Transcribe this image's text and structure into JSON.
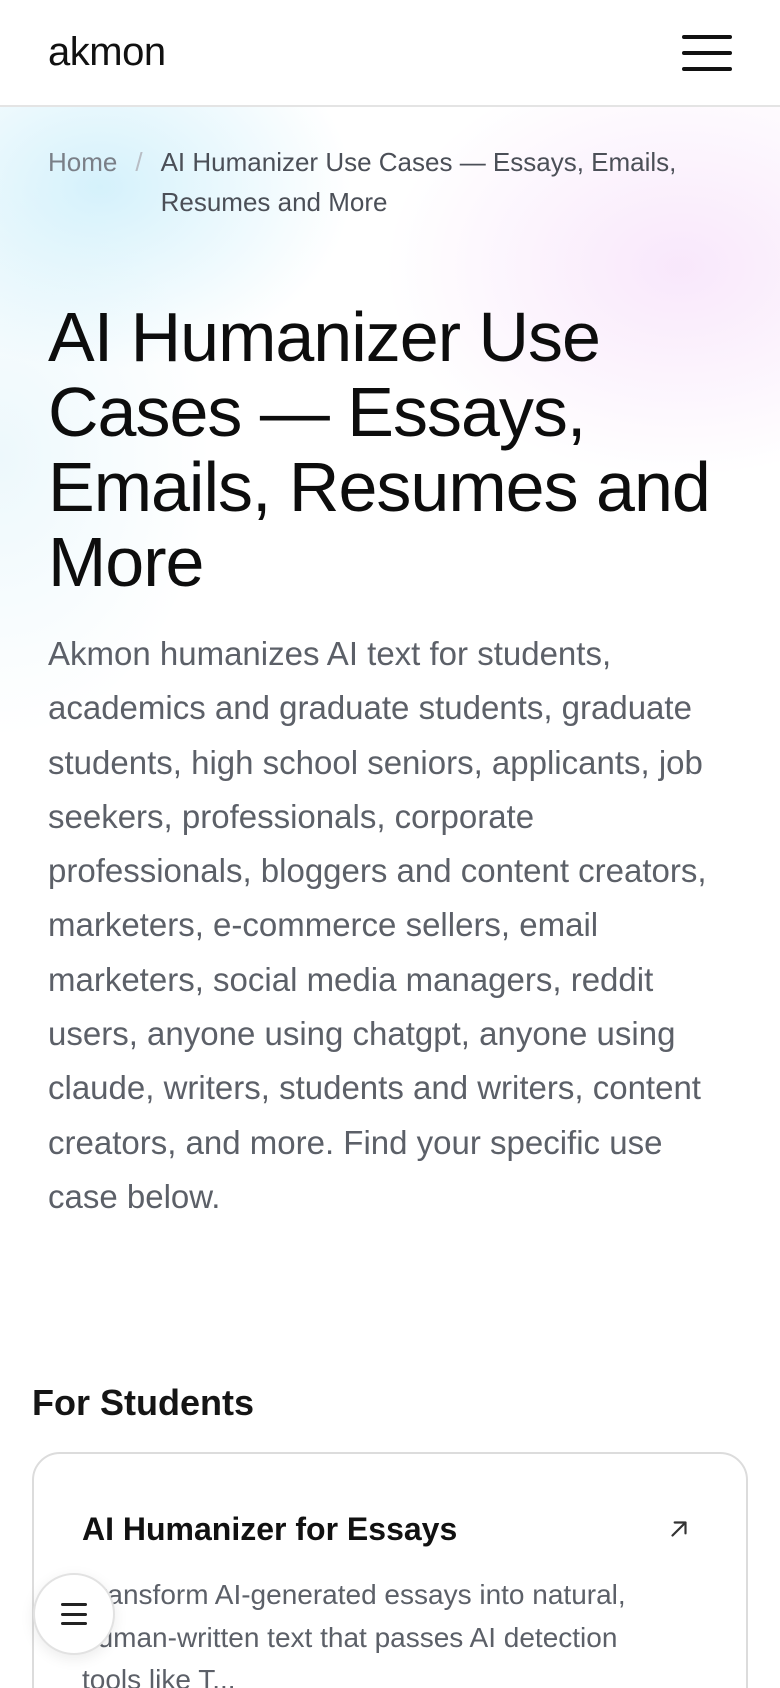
{
  "header": {
    "logo": "akmon",
    "menu_icon": "hamburger-menu-icon"
  },
  "breadcrumb": {
    "home": "Home",
    "separator": "/",
    "current": "AI Humanizer Use Cases — Essays, Emails, Resumes and More"
  },
  "hero": {
    "title": "AI Humanizer Use Cases — Essays, Emails, Resumes and More",
    "description": "Akmon humanizes AI text for students, academics and graduate students, graduate students, high school seniors, applicants, job seekers, professionals, corporate professionals, bloggers and content creators, marketers, e-commerce sellers, email marketers, social media managers, reddit users, anyone using chatgpt, anyone using claude, writers, students and writers, content creators, and more. Find your specific use case below."
  },
  "sections": [
    {
      "title": "For Students",
      "cards": [
        {
          "title": "AI Humanizer for Essays",
          "description": "Transform AI-generated essays into natural, human-written text that passes AI detection tools like T...",
          "icon": "arrow-up-right-icon"
        }
      ]
    }
  ],
  "floating_button": {
    "icon": "menu-lines-icon"
  },
  "colors": {
    "text_primary": "#0d0d0d",
    "text_secondary": "#5c6068",
    "border": "#dcdcdc",
    "gradient_blue": "#b2e6f8",
    "gradient_pink": "#f3d4f8"
  }
}
